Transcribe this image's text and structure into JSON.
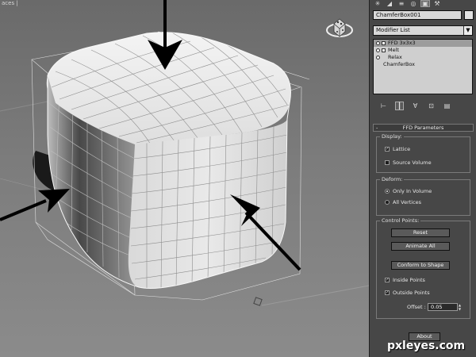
{
  "viewport": {
    "label": "aces |"
  },
  "panel": {
    "tabs": [
      {
        "name": "create-tab",
        "glyph": "✳"
      },
      {
        "name": "modify-tab",
        "glyph": "◢"
      },
      {
        "name": "hierarchy-tab",
        "glyph": "≡"
      },
      {
        "name": "motion-tab",
        "glyph": "◎"
      },
      {
        "name": "display-tab",
        "glyph": "▣"
      },
      {
        "name": "utilities-tab",
        "glyph": "⚒"
      }
    ],
    "object_name": "ChamferBox001",
    "modifier_list_label": "Modifier List",
    "modifier_list_arrow": "▼",
    "stack": [
      {
        "label": "FFD 3x3x3",
        "selected": true
      },
      {
        "label": "Melt",
        "selected": false
      },
      {
        "label": "Relax",
        "selected": false
      }
    ],
    "stack_base": "ChamferBox",
    "stack_tools": [
      "⊢",
      "┃",
      "∀",
      "⊡",
      "▤"
    ]
  },
  "ffd": {
    "title": "FFD Parameters",
    "minus": "-",
    "display_group": "Display:",
    "lattice": "Lattice",
    "source_volume": "Source Volume",
    "deform_group": "Deform:",
    "only_in_volume": "Only In Volume",
    "all_vertices": "All Vertices",
    "control_group": "Control Points:",
    "reset": "Reset",
    "animate_all": "Animate All",
    "conform": "Conform to Shape",
    "inside_points": "Inside Points",
    "outside_points": "Outside Points",
    "offset_label": "Offset :",
    "offset_value": "0.05",
    "about": "About",
    "check": "✓"
  },
  "watermark": "pxleyes.com"
}
